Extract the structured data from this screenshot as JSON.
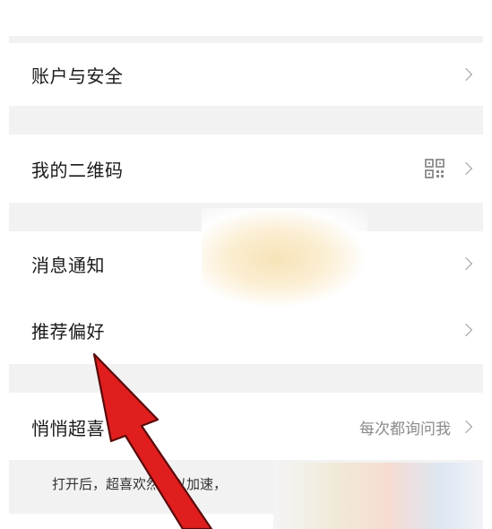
{
  "settings": {
    "items": [
      {
        "label": "账户与安全"
      },
      {
        "label": "我的二维码",
        "icon": "qr-code-icon"
      },
      {
        "label": "消息通知"
      },
      {
        "label": "推荐偏好"
      },
      {
        "label": "悄悄超喜",
        "value": "每次都询问我"
      }
    ],
    "hint": "打开后，超喜欢然可以加速，"
  },
  "colors": {
    "page_background": "#f2f2f2",
    "cell_background": "#ffffff",
    "annotation_arrow": "#e01e1e"
  },
  "icons": [
    "chevron-right-icon",
    "qr-code-icon",
    "annotation-arrow"
  ]
}
